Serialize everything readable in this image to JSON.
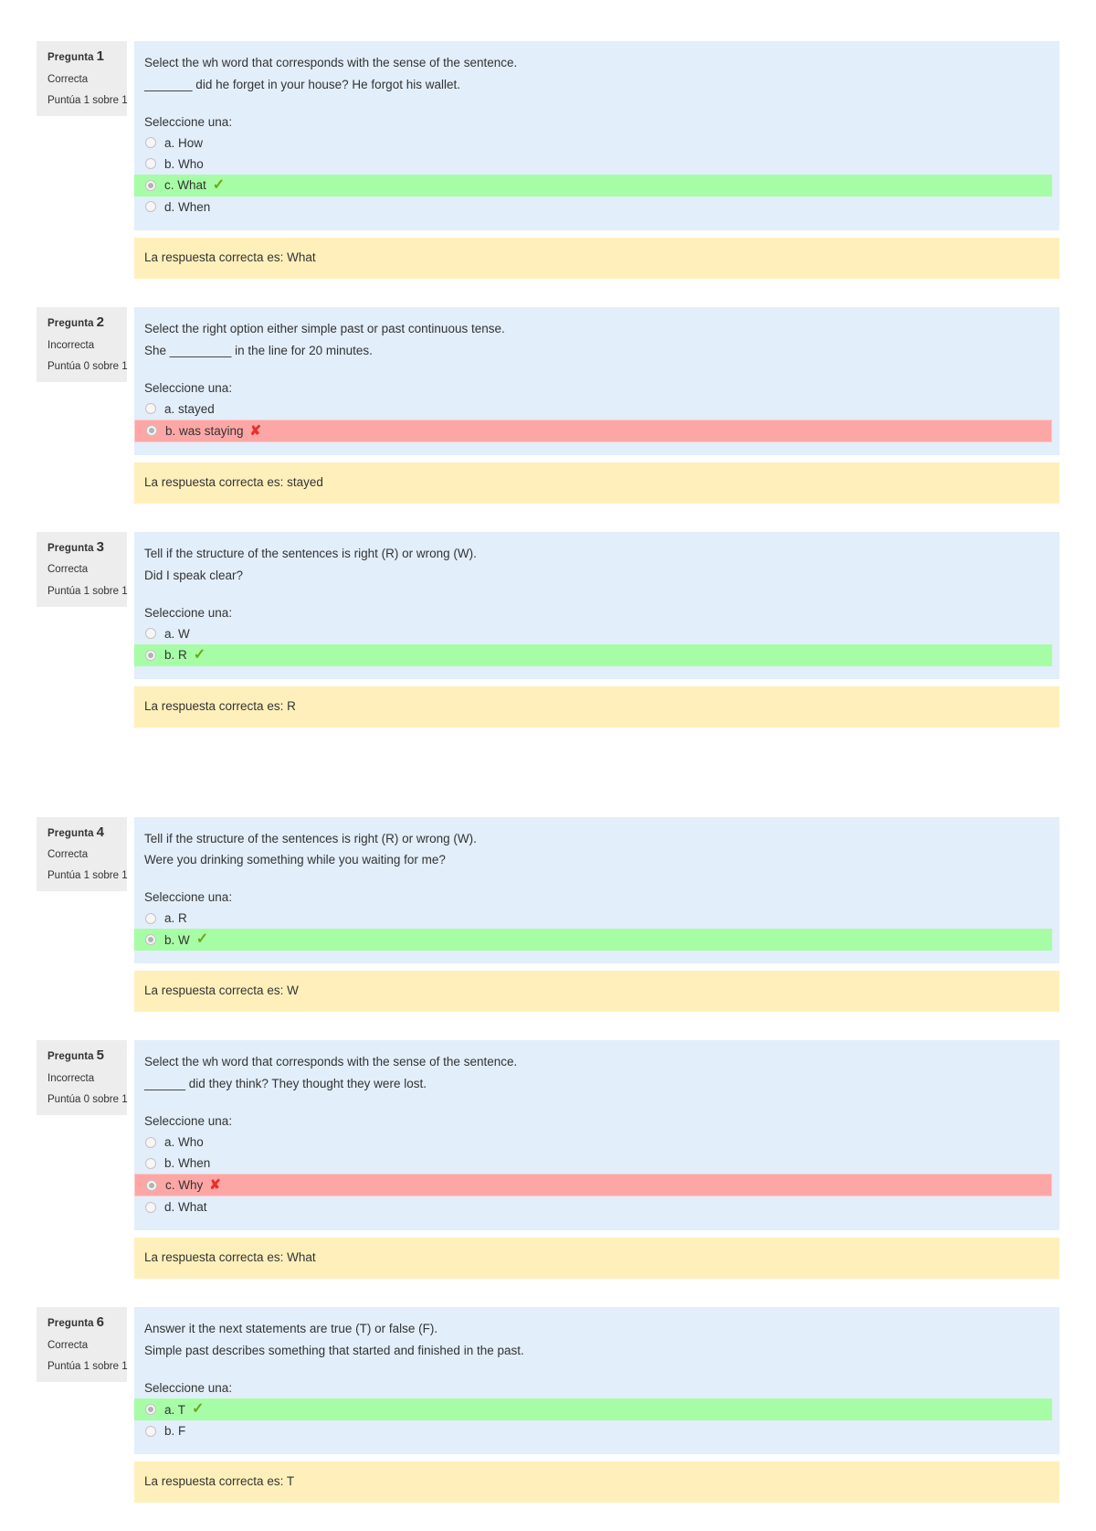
{
  "labels": {
    "question_word": "Pregunta",
    "select_one": "Seleccione una:",
    "correct_state": "Correcta",
    "incorrect_state": "Incorrecta",
    "feedback_prefix": "La respuesta correcta es:"
  },
  "colors": {
    "page_background": "#ffffff",
    "info_background": "#ededed",
    "content_background": "#e2eefa",
    "correct_background": "#a6fda6",
    "incorrect_background": "#fda6a6",
    "feedback_background": "#fff0bb",
    "tick_color": "#6aab16",
    "cross_color": "#e8302a"
  },
  "questions": [
    {
      "number": "1",
      "info_label": "Pregunta",
      "state": "Correcta",
      "grade": "Puntúa 1 sobre 1",
      "instruction": "Select the wh word that corresponds with the sense of the sentence.",
      "sentence": "_______ did he forget in your house? He forgot his wallet.",
      "prompt": "Seleccione una:",
      "options": [
        {
          "label": "a. How",
          "selected": false,
          "mark": ""
        },
        {
          "label": "b. Who",
          "selected": false,
          "mark": ""
        },
        {
          "label": "c. What",
          "selected": true,
          "mark": "correct"
        },
        {
          "label": "d. When",
          "selected": false,
          "mark": ""
        }
      ],
      "feedback": "La respuesta correcta es: What",
      "gap_after": false
    },
    {
      "number": "2",
      "info_label": "Pregunta",
      "state": "Incorrecta",
      "grade": "Puntúa 0 sobre 1",
      "instruction": "Select the right option either simple past or past continuous tense.",
      "sentence": "She _________ in the line for 20 minutes.",
      "prompt": "Seleccione una:",
      "options": [
        {
          "label": "a. stayed",
          "selected": false,
          "mark": ""
        },
        {
          "label": "b. was staying",
          "selected": true,
          "mark": "incorrect"
        }
      ],
      "feedback": "La respuesta correcta es: stayed",
      "gap_after": false
    },
    {
      "number": "3",
      "info_label": "Pregunta",
      "state": "Correcta",
      "grade": "Puntúa 1 sobre 1",
      "instruction": "Tell if the structure of the sentences is right (R) or wrong (W).",
      "sentence": "Did I speak clear?",
      "prompt": "Seleccione una:",
      "options": [
        {
          "label": "a. W",
          "selected": false,
          "mark": ""
        },
        {
          "label": "b. R",
          "selected": true,
          "mark": "correct"
        }
      ],
      "feedback": "La respuesta correcta es: R",
      "gap_after": true
    },
    {
      "number": "4",
      "info_label": "Pregunta",
      "state": "Correcta",
      "grade": "Puntúa 1 sobre 1",
      "instruction": "Tell if the structure of the sentences is right (R) or wrong (W).",
      "sentence": "Were you drinking something while you waiting for me?",
      "prompt": "Seleccione una:",
      "options": [
        {
          "label": "a. R",
          "selected": false,
          "mark": ""
        },
        {
          "label": "b. W",
          "selected": true,
          "mark": "correct"
        }
      ],
      "feedback": "La respuesta correcta es: W",
      "gap_after": false
    },
    {
      "number": "5",
      "info_label": "Pregunta",
      "state": "Incorrecta",
      "grade": "Puntúa 0 sobre 1",
      "instruction": "Select the wh word that corresponds with the sense of the sentence.",
      "sentence": "______ did they think? They thought they were lost.",
      "prompt": "Seleccione una:",
      "options": [
        {
          "label": "a. Who",
          "selected": false,
          "mark": ""
        },
        {
          "label": "b. When",
          "selected": false,
          "mark": ""
        },
        {
          "label": "c. Why",
          "selected": true,
          "mark": "incorrect"
        },
        {
          "label": "d. What",
          "selected": false,
          "mark": ""
        }
      ],
      "feedback": "La respuesta correcta es: What",
      "gap_after": false
    },
    {
      "number": "6",
      "info_label": "Pregunta",
      "state": "Correcta",
      "grade": "Puntúa 1 sobre 1",
      "instruction": "Answer it the next statements are true (T) or false (F).",
      "sentence": "Simple past describes something that started and finished in the past.",
      "prompt": "Seleccione una:",
      "options": [
        {
          "label": "a. T",
          "selected": true,
          "mark": "correct"
        },
        {
          "label": "b. F",
          "selected": false,
          "mark": ""
        }
      ],
      "feedback": "La respuesta correcta es: T",
      "gap_after": false
    }
  ]
}
